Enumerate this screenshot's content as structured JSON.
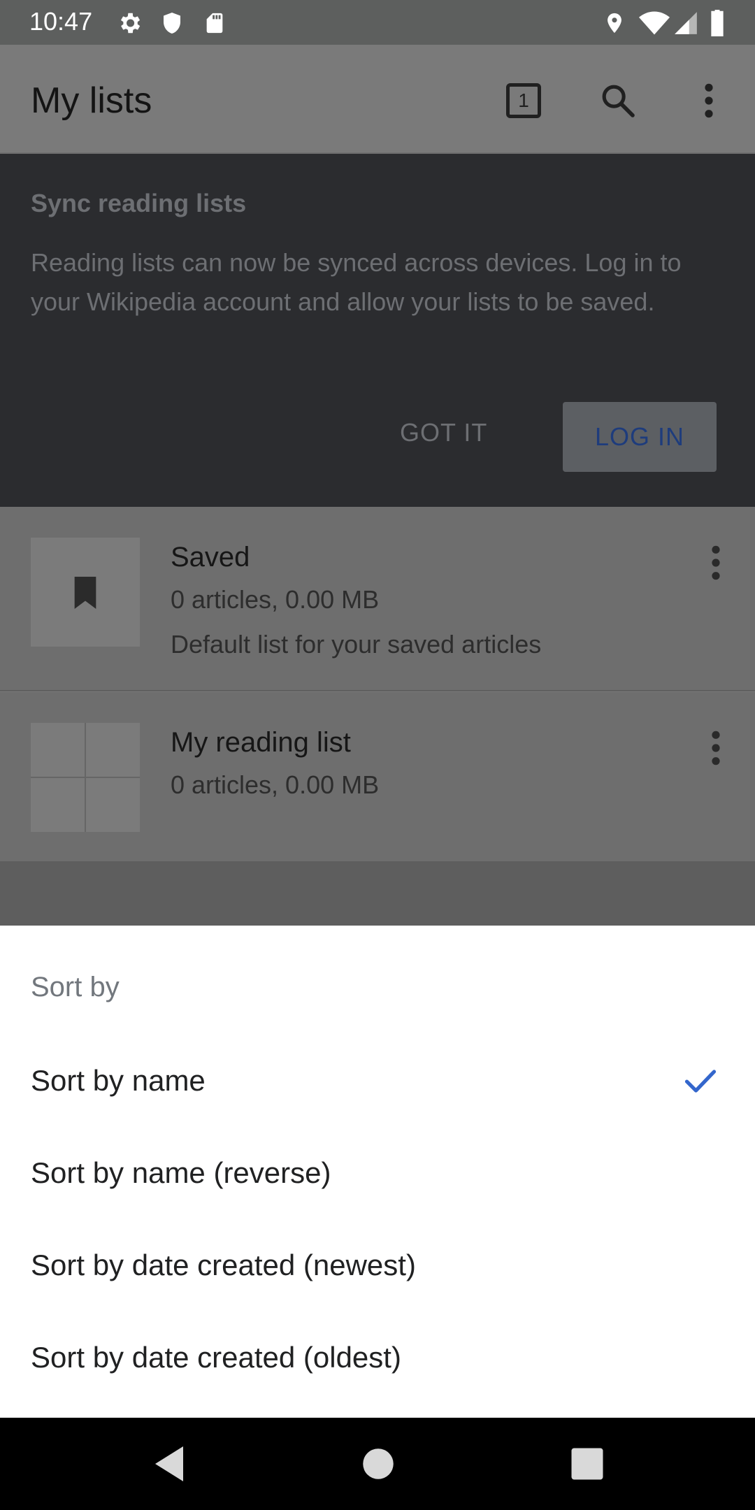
{
  "status_bar": {
    "time": "10:47"
  },
  "app_bar": {
    "title": "My lists",
    "tab_count": "1"
  },
  "sync_card": {
    "title": "Sync reading lists",
    "text": "Reading lists can now be synced across devices. Log in to your Wikipedia account and allow your lists to be saved.",
    "got_it": "GOT IT",
    "log_in": "LOG IN"
  },
  "lists": [
    {
      "title": "Saved",
      "subtitle": "0 articles, 0.00 MB",
      "description": "Default list for your saved articles"
    },
    {
      "title": "My reading list",
      "subtitle": "0 articles, 0.00 MB"
    }
  ],
  "sort_sheet": {
    "title": "Sort by",
    "options": [
      {
        "label": "Sort by name",
        "selected": true
      },
      {
        "label": "Sort by name (reverse)",
        "selected": false
      },
      {
        "label": "Sort by date created (newest)",
        "selected": false
      },
      {
        "label": "Sort by date created (oldest)",
        "selected": false
      }
    ]
  },
  "colors": {
    "accent": "#3366cc",
    "scrim": "#7a7a7a",
    "sheet": "#ffffff"
  },
  "icons": [
    "settings-icon",
    "shield-icon",
    "sd-card-icon",
    "location-icon",
    "wifi-icon",
    "signal-icon",
    "battery-icon",
    "tabs-icon",
    "search-icon",
    "more-vert-icon",
    "bookmark-icon",
    "check-icon",
    "back-icon",
    "home-icon",
    "recents-icon"
  ]
}
